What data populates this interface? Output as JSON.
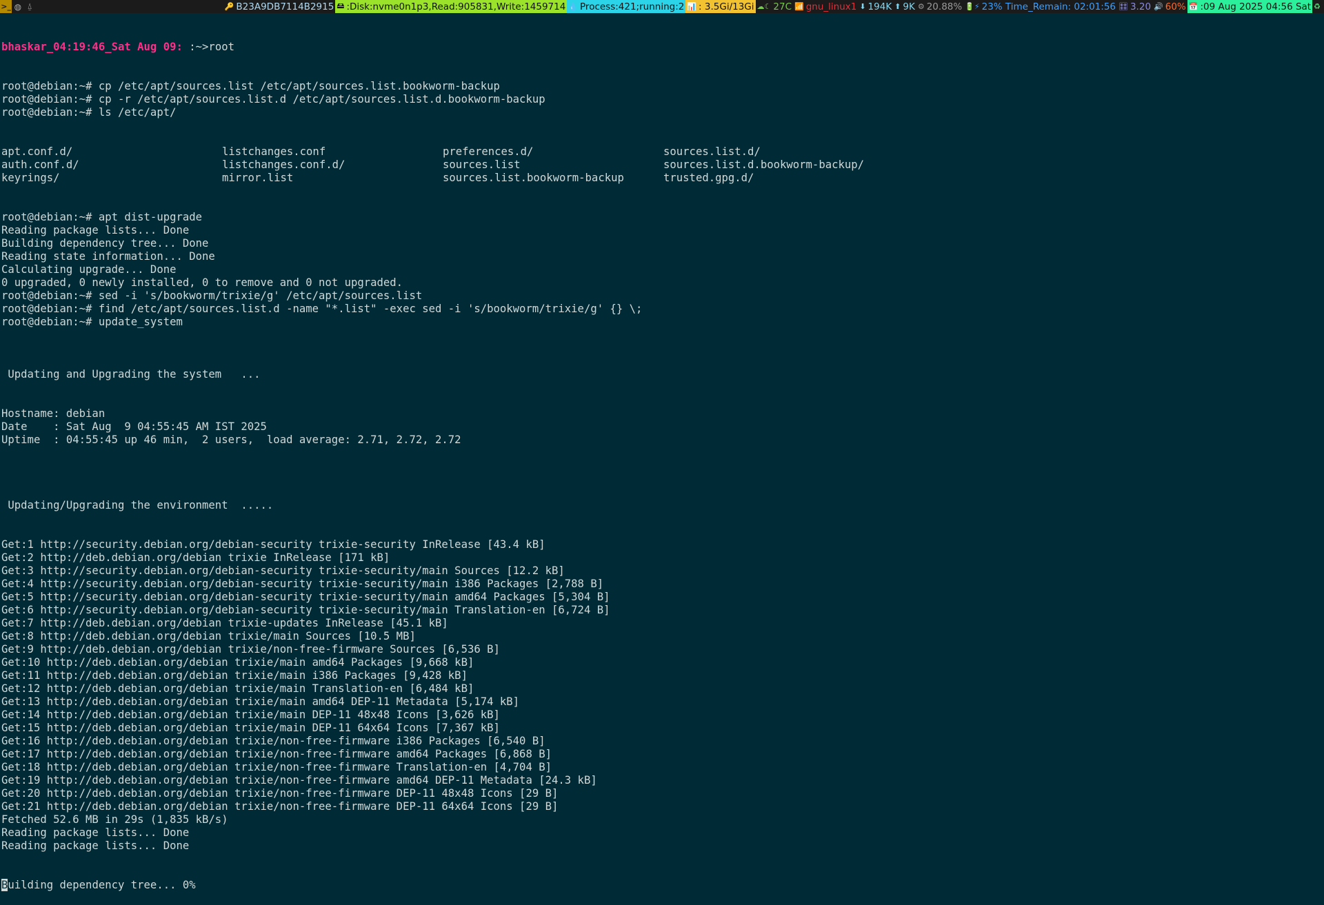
{
  "bar": {
    "term_glyph": ">_",
    "ws_icons": [
      "◍",
      "⍙"
    ],
    "segments": [
      {
        "name": "machine-id",
        "icon": "🔑",
        "text": "B23A9DB7114B2915",
        "color": "#b0d8f0",
        "bg": ""
      },
      {
        "name": "disk",
        "icon": "🖴",
        "text": ":Disk:nvme0n1p3,Read:905831,Write:1459714",
        "color": "#111111",
        "bg": "#9be32b"
      },
      {
        "name": "process",
        "icon": "💧",
        "text": "Process:421;running:2",
        "color": "#111111",
        "bg": "#2bd4e8"
      },
      {
        "name": "memory",
        "icon": "📊",
        "text": ": 3.5Gi/13Gi",
        "color": "#111111",
        "bg": "#f2c230"
      },
      {
        "name": "weather",
        "icon": "☁☾",
        "text": "27C",
        "color": "#78c850",
        "bg": ""
      },
      {
        "name": "wifi",
        "icon": "📶",
        "text": "gnu_linux1",
        "color": "#e0303a",
        "bg": ""
      },
      {
        "name": "net-down",
        "icon": "⬇",
        "text": "194K",
        "color": "#7fd6f0",
        "bg": ""
      },
      {
        "name": "net-up",
        "icon": "⬆",
        "text": "9K",
        "color": "#7fd6f0",
        "bg": ""
      },
      {
        "name": "cpu",
        "icon": "⚙",
        "text": "20.88%",
        "color": "#9a9a9a",
        "bg": ""
      },
      {
        "name": "battery",
        "icon": "🔋⚡",
        "text": "23% Time_Remain: 02:01:56",
        "color": "#3aa0ff",
        "bg": ""
      },
      {
        "name": "load",
        "icon": "🎛",
        "text": "3.20",
        "color": "#8a8ae0",
        "bg": ""
      },
      {
        "name": "volume",
        "icon": "🔊",
        "text": "60%",
        "color": "#ff6a2b",
        "bg": ""
      },
      {
        "name": "datetime",
        "icon": "📅",
        "text": ":09 Aug 2025 04:56 Sat",
        "color": "#111111",
        "bg": "#2bef9a"
      },
      {
        "name": "tray",
        "icon": "♻",
        "text": "",
        "color": "#56e07a",
        "bg": ""
      }
    ]
  },
  "term": {
    "first_prompt": {
      "host": "bhaskar_04:19:46_Sat Aug 09:",
      "rest": " :~>root"
    },
    "lines_a": [
      "root@debian:~# cp /etc/apt/sources.list /etc/apt/sources.list.bookworm-backup",
      "root@debian:~# cp -r /etc/apt/sources.list.d /etc/apt/sources.list.d.bookworm-backup",
      "root@debian:~# ls /etc/apt/"
    ],
    "ls_rows": [
      [
        "apt.conf.d/",
        "listchanges.conf",
        "preferences.d/",
        "sources.list.d/"
      ],
      [
        "auth.conf.d/",
        "listchanges.conf.d/",
        "sources.list",
        "sources.list.d.bookworm-backup/"
      ],
      [
        "keyrings/",
        "mirror.list",
        "sources.list.bookworm-backup",
        "trusted.gpg.d/"
      ]
    ],
    "lines_b": [
      "root@debian:~# apt dist-upgrade",
      "Reading package lists... Done",
      "Building dependency tree... Done",
      "Reading state information... Done",
      "Calculating upgrade... Done",
      "0 upgraded, 0 newly installed, 0 to remove and 0 not upgraded.",
      "root@debian:~# sed -i 's/bookworm/trixie/g' /etc/apt/sources.list",
      "root@debian:~# find /etc/apt/sources.list.d -name \"*.list\" -exec sed -i 's/bookworm/trixie/g' {} \\;",
      "root@debian:~# update_system",
      "",
      "",
      "",
      " Updating and Upgrading the system   ...",
      "",
      "",
      "Hostname: debian",
      "Date    : Sat Aug  9 04:55:45 AM IST 2025",
      "Uptime  : 04:55:45 up 46 min,  2 users,  load average: 2.71, 2.72, 2.72",
      "",
      "",
      "",
      "",
      " Updating/Upgrading the environment  .....",
      "",
      "",
      "Get:1 http://security.debian.org/debian-security trixie-security InRelease [43.4 kB]",
      "Get:2 http://deb.debian.org/debian trixie InRelease [171 kB]",
      "Get:3 http://security.debian.org/debian-security trixie-security/main Sources [12.2 kB]",
      "Get:4 http://security.debian.org/debian-security trixie-security/main i386 Packages [2,788 B]",
      "Get:5 http://security.debian.org/debian-security trixie-security/main amd64 Packages [5,304 B]",
      "Get:6 http://security.debian.org/debian-security trixie-security/main Translation-en [6,724 B]",
      "Get:7 http://deb.debian.org/debian trixie-updates InRelease [45.1 kB]",
      "Get:8 http://deb.debian.org/debian trixie/main Sources [10.5 MB]",
      "Get:9 http://deb.debian.org/debian trixie/non-free-firmware Sources [6,536 B]",
      "Get:10 http://deb.debian.org/debian trixie/main amd64 Packages [9,668 kB]",
      "Get:11 http://deb.debian.org/debian trixie/main i386 Packages [9,428 kB]",
      "Get:12 http://deb.debian.org/debian trixie/main Translation-en [6,484 kB]",
      "Get:13 http://deb.debian.org/debian trixie/main amd64 DEP-11 Metadata [5,174 kB]",
      "Get:14 http://deb.debian.org/debian trixie/main DEP-11 48x48 Icons [3,626 kB]",
      "Get:15 http://deb.debian.org/debian trixie/main DEP-11 64x64 Icons [7,367 kB]",
      "Get:16 http://deb.debian.org/debian trixie/non-free-firmware i386 Packages [6,540 B]",
      "Get:17 http://deb.debian.org/debian trixie/non-free-firmware amd64 Packages [6,868 B]",
      "Get:18 http://deb.debian.org/debian trixie/non-free-firmware Translation-en [4,704 B]",
      "Get:19 http://deb.debian.org/debian trixie/non-free-firmware amd64 DEP-11 Metadata [24.3 kB]",
      "Get:20 http://deb.debian.org/debian trixie/non-free-firmware DEP-11 48x48 Icons [29 B]",
      "Get:21 http://deb.debian.org/debian trixie/non-free-firmware DEP-11 64x64 Icons [29 B]",
      "Fetched 52.6 MB in 29s (1,835 kB/s)",
      "Reading package lists... Done",
      "Reading package lists... Done"
    ],
    "last_line": {
      "cursor_char": "B",
      "rest": "uilding dependency tree... 0%"
    }
  }
}
